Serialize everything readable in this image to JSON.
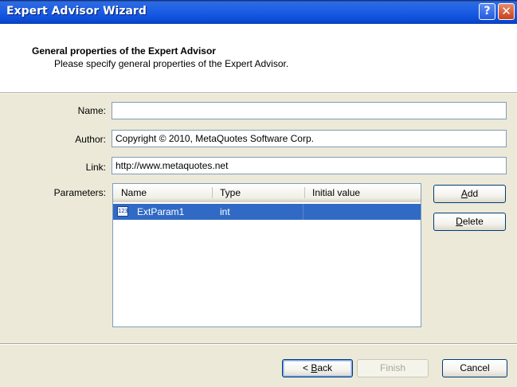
{
  "window": {
    "title": "Expert Advisor Wizard",
    "help_glyph": "?",
    "close_glyph": "✕"
  },
  "header": {
    "title": "General properties of the Expert Advisor",
    "subtitle": "Please specify general properties of the Expert Advisor."
  },
  "form": {
    "name_label": "Name:",
    "name_value": "",
    "author_label": "Author:",
    "author_value": "Copyright © 2010, MetaQuotes Software Corp.",
    "link_label": "Link:",
    "link_value": "http://www.metaquotes.net",
    "parameters_label": "Parameters:"
  },
  "parameters": {
    "columns": [
      "Name",
      "Type",
      "Initial value"
    ],
    "rows": [
      {
        "name": "ExtParam1",
        "type": "int",
        "initial": "",
        "icon": "parameter-icon",
        "icon_text": "123",
        "selected": true
      }
    ]
  },
  "buttons": {
    "add": {
      "pre": "",
      "key": "A",
      "post": "dd"
    },
    "delete": {
      "pre": "",
      "key": "D",
      "post": "elete"
    },
    "back": {
      "pre": "< ",
      "key": "B",
      "post": "ack"
    },
    "finish": "Finish",
    "cancel": "Cancel"
  },
  "colors": {
    "title_bar": "#1c5fe6",
    "selection": "#316ac5",
    "dialog_bg": "#ece9d8"
  }
}
